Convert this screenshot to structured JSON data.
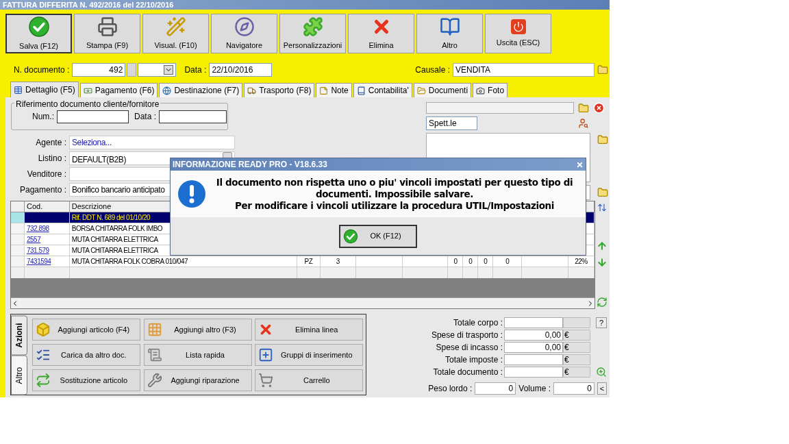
{
  "window": {
    "title": "FATTURA DIFFERITA N. 492/2016 del 22/10/2016"
  },
  "toolbar": [
    {
      "label": "Salva (F12)",
      "kind": "save",
      "focused": true
    },
    {
      "label": "Stampa (F9)",
      "kind": "print",
      "focused": false
    },
    {
      "label": "Visual. (F10)",
      "kind": "preview",
      "focused": false
    },
    {
      "label": "Navigatore",
      "kind": "navigator",
      "focused": false
    },
    {
      "label": "Personalizzazioni",
      "kind": "custom",
      "focused": false
    },
    {
      "label": "Elimina",
      "kind": "delete",
      "focused": false
    },
    {
      "label": "Altro",
      "kind": "other",
      "focused": false
    },
    {
      "label": "Uscita (ESC)",
      "kind": "exit",
      "focused": false
    }
  ],
  "header": {
    "doc_number_label": "N. documento :",
    "doc_number": "492",
    "date_label": "Data :",
    "date": "22/10/2016",
    "causale_label": "Causale :",
    "causale": "VENDITA"
  },
  "tabs": [
    {
      "label": "Dettaglio (F5)",
      "kind": "detail",
      "selected": true
    },
    {
      "label": "Pagamento (F6)",
      "kind": "payment",
      "selected": false
    },
    {
      "label": "Destinazione (F7)",
      "kind": "destination",
      "selected": false
    },
    {
      "label": "Trasporto (F8)",
      "kind": "transport",
      "selected": false
    },
    {
      "label": "Note",
      "kind": "note",
      "selected": false
    },
    {
      "label": "Contabilita'",
      "kind": "accounting",
      "selected": false
    },
    {
      "label": "Documenti",
      "kind": "documents",
      "selected": false
    },
    {
      "label": "Foto",
      "kind": "photo",
      "selected": false
    }
  ],
  "reference": {
    "legend": "Riferimento documento cliente/fornitore",
    "num_label": "Num.:",
    "date_label": "Data :"
  },
  "fields": [
    {
      "label": "Agente :",
      "value": "Seleziona...",
      "kind": "link"
    },
    {
      "label": "Listino :",
      "value": "DEFAULT(B2B)",
      "kind": "combo"
    },
    {
      "label": "Venditore :",
      "kind": "link"
    },
    {
      "label": "Pagamento :",
      "value": "Bonifico bancario anticipato",
      "kind": "text"
    }
  ],
  "customer": {
    "title": "Spett.le"
  },
  "table": {
    "columns": [
      "Cod.",
      "Descrizione"
    ],
    "rows": [
      {
        "code": "",
        "description": "Rif. DDT N. 689 del 01/10/20",
        "selected": true
      },
      {
        "code": "732.898",
        "description": "BORSA CHITARRA FOLK IMBO",
        "selected": false
      },
      {
        "code": "2557",
        "description": "MUTA CHITARRA ELETTRICA",
        "selected": false
      },
      {
        "code": "731.579",
        "description": "MUTA CHITARRA ELETTRICA",
        "selected": false
      },
      {
        "code": "7431594",
        "description": "MUTA CHITARRA FOLK COBRA 010/047",
        "unit": "PZ",
        "qty": "3",
        "discounts": [
          "0",
          "0",
          "0",
          "0"
        ],
        "vat": "22%",
        "selected": false
      }
    ]
  },
  "actions": {
    "tabs": [
      {
        "label": "Azioni",
        "selected": true
      },
      {
        "label": "Altro",
        "selected": false
      }
    ],
    "buttons": [
      {
        "label": "Aggiungi articolo (F4)",
        "kind": "add-item"
      },
      {
        "label": "Aggiungi altro (F3)",
        "kind": "add-other"
      },
      {
        "label": "Elimina linea",
        "kind": "delete"
      },
      {
        "label": "Carica da altro doc.",
        "kind": "load"
      },
      {
        "label": "Lista rapida",
        "kind": "list"
      },
      {
        "label": "Gruppi di inserimento",
        "kind": "group"
      },
      {
        "label": "Sostituzione articolo",
        "kind": "replace"
      },
      {
        "label": "Aggiungi riparazione",
        "kind": "repair"
      },
      {
        "label": "Carrello",
        "kind": "cart"
      }
    ]
  },
  "totals": [
    {
      "label": "Totale corpo :",
      "kind": "help",
      "extra": "?"
    },
    {
      "label": "Spese di trasporto :",
      "value": "0,00",
      "currency": "€",
      "kind": "plain"
    },
    {
      "label": "Spese di incasso :",
      "value": "0,00",
      "currency": "€",
      "kind": "plain"
    },
    {
      "label": "Totale imposte :",
      "currency": "€",
      "kind": "plain"
    },
    {
      "label": "Totale documento :",
      "currency": "€",
      "kind": "zoom"
    }
  ],
  "measures": [
    {
      "label": "Peso lordo :",
      "value": "0"
    },
    {
      "label": "Volume :",
      "value": "0"
    }
  ],
  "measures_button": "<",
  "dialog": {
    "title": "INFORMAZIONE READY PRO - V18.6.33",
    "lines": [
      "Il documento non rispetta uno o piu' vincoli impostati per questo tipo di documenti. Impossibile salvare.",
      "Per modificare i vincoli utilizzare la procedura UTIL/Impostazioni"
    ],
    "button": "OK (F12)"
  }
}
